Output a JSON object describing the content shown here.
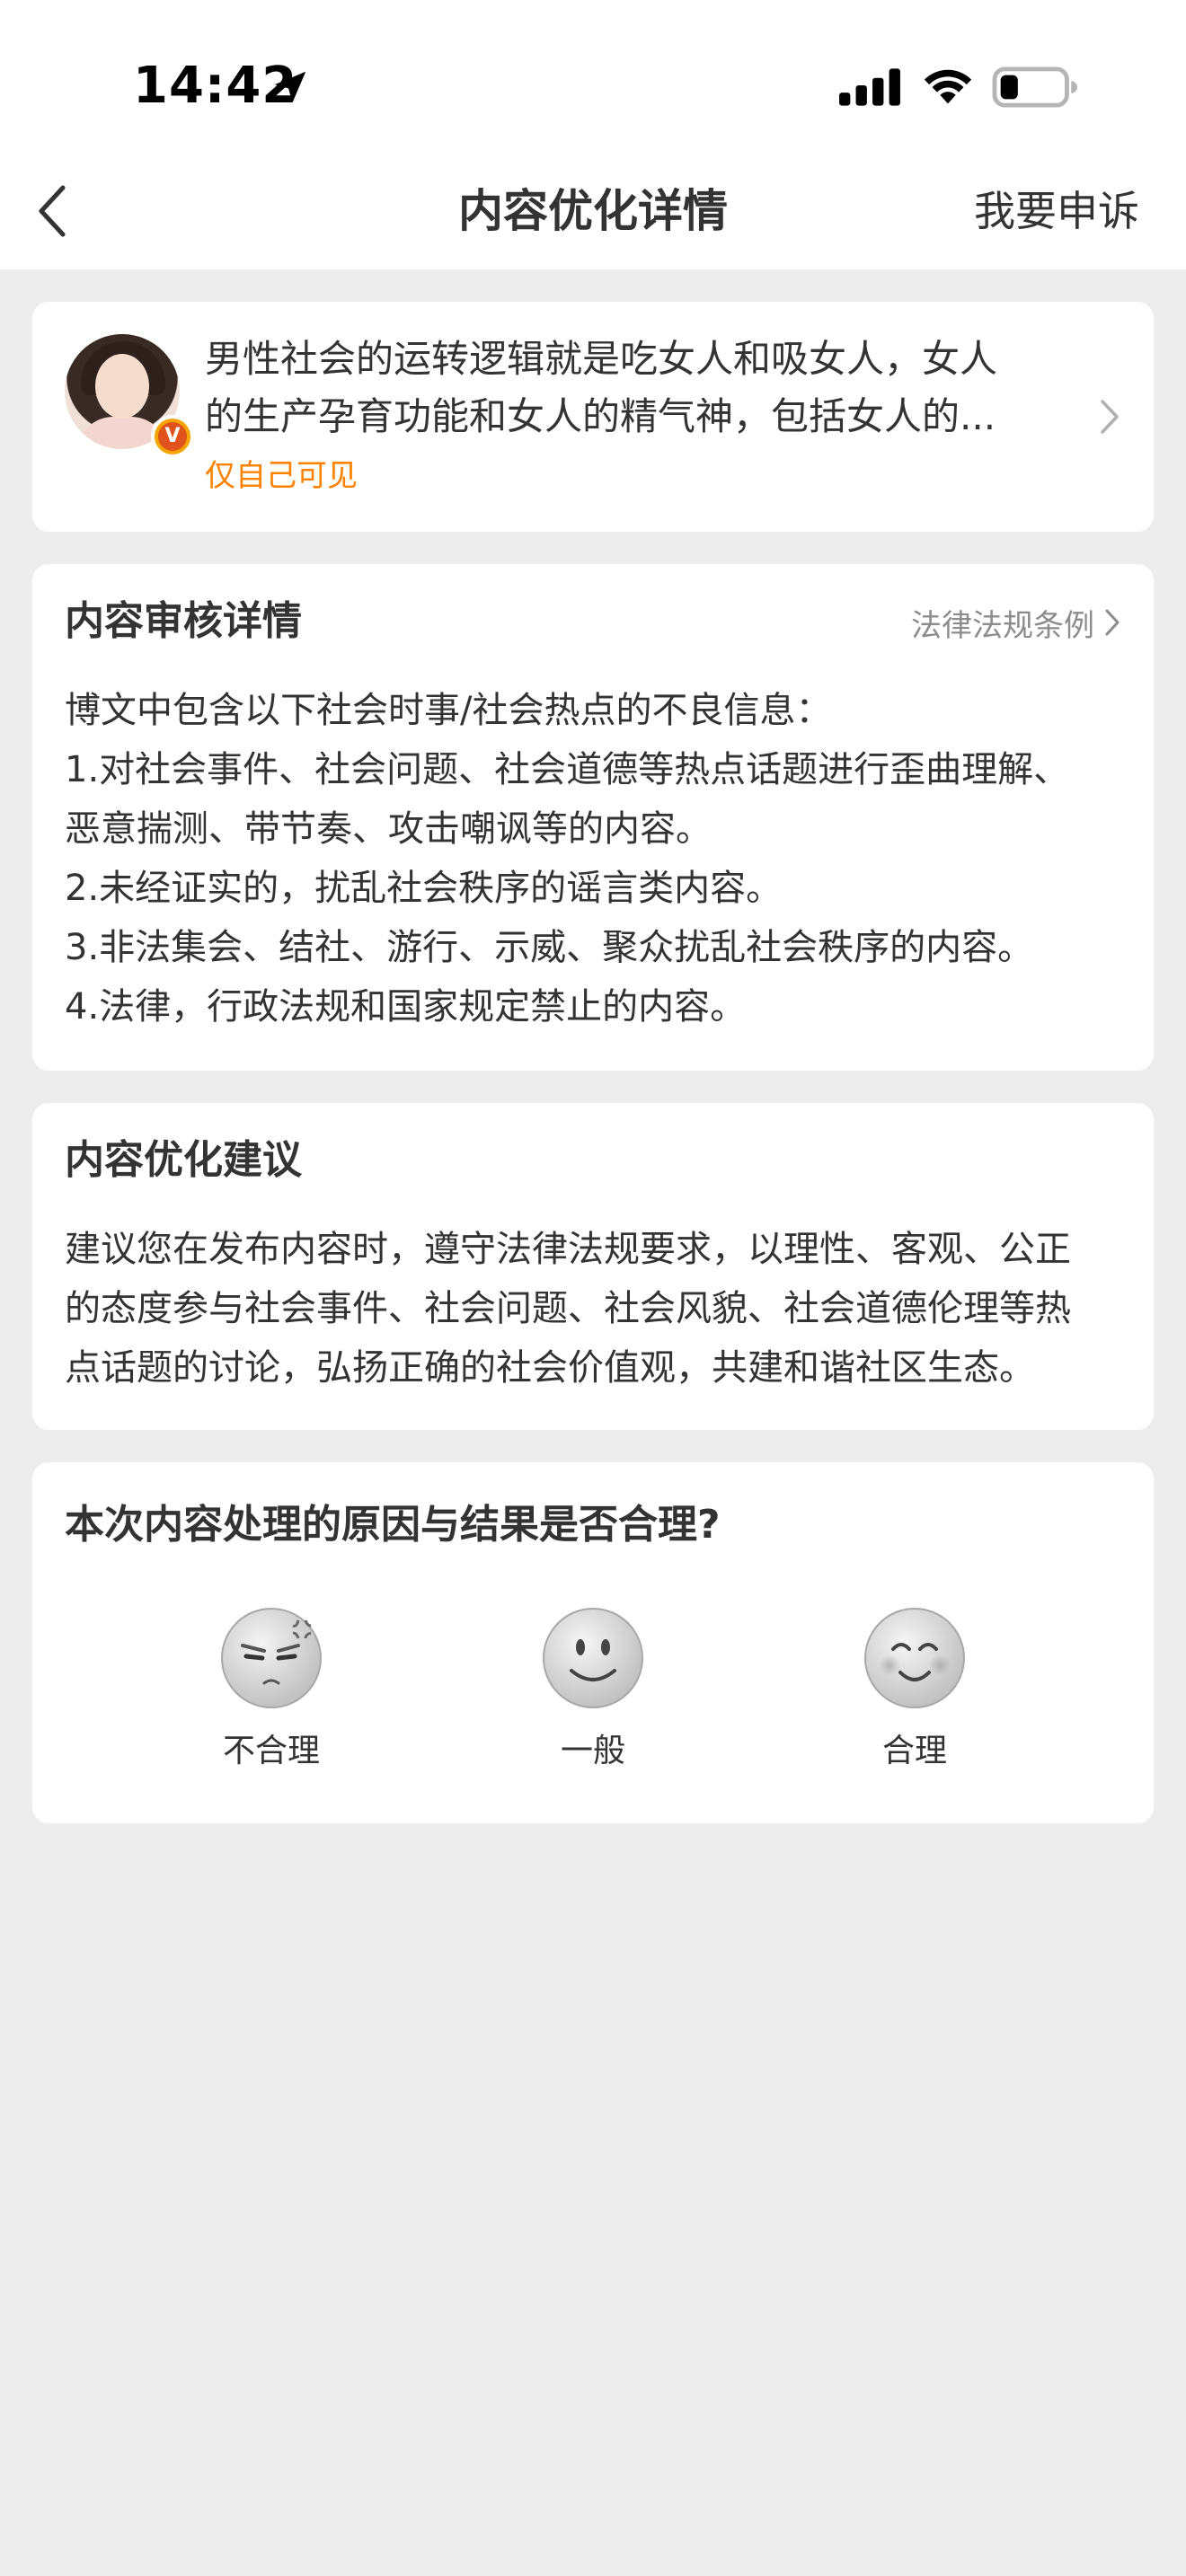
{
  "status_bar": {
    "time": "14:42",
    "icons": [
      "location-arrow-icon",
      "cellular-signal-icon",
      "wifi-icon",
      "battery-low-icon"
    ]
  },
  "nav": {
    "back_icon": "chevron-left-icon",
    "title": "内容优化详情",
    "appeal_label": "我要申诉"
  },
  "post": {
    "text_line1": "男性社会的运转逻辑就是吃女人和吸女人，女人",
    "text_line2": "的生产孕育功能和女人的精气神，包括女人的...",
    "visibility": "仅自己可见",
    "badge": "V"
  },
  "review": {
    "heading": "内容审核详情",
    "law_link": "法律法规条例",
    "lines": [
      "博文中包含以下社会时事/社会热点的不良信息：",
      "1.对社会事件、社会问题、社会道德等热点话题进行歪曲理解、",
      "恶意揣测、带节奏、攻击嘲讽等的内容。",
      "2.未经证实的，扰乱社会秩序的谣言类内容。",
      "3.非法集会、结社、游行、示威、聚众扰乱社会秩序的内容。",
      "4.法律，行政法规和国家规定禁止的内容。"
    ]
  },
  "suggestion": {
    "heading": "内容优化建议",
    "lines": [
      "建议您在发布内容时，遵守法律法规要求，以理性、客观、公正",
      "的态度参与社会事件、社会问题、社会风貌、社会道德伦理等热",
      "点话题的讨论，弘扬正确的社会价值观，共建和谐社区生态。"
    ]
  },
  "feedback": {
    "question": "本次内容处理的原因与结果是否合理?",
    "options": [
      {
        "label": "不合理",
        "icon": "annoyed-face-icon"
      },
      {
        "label": "一般",
        "icon": "neutral-face-icon"
      },
      {
        "label": "合理",
        "icon": "happy-face-icon"
      }
    ]
  },
  "colors": {
    "background": "#ededed",
    "card": "#ffffff",
    "accent_orange": "#ff8200",
    "text": "#333333",
    "secondary_text": "#8c8c8c"
  }
}
